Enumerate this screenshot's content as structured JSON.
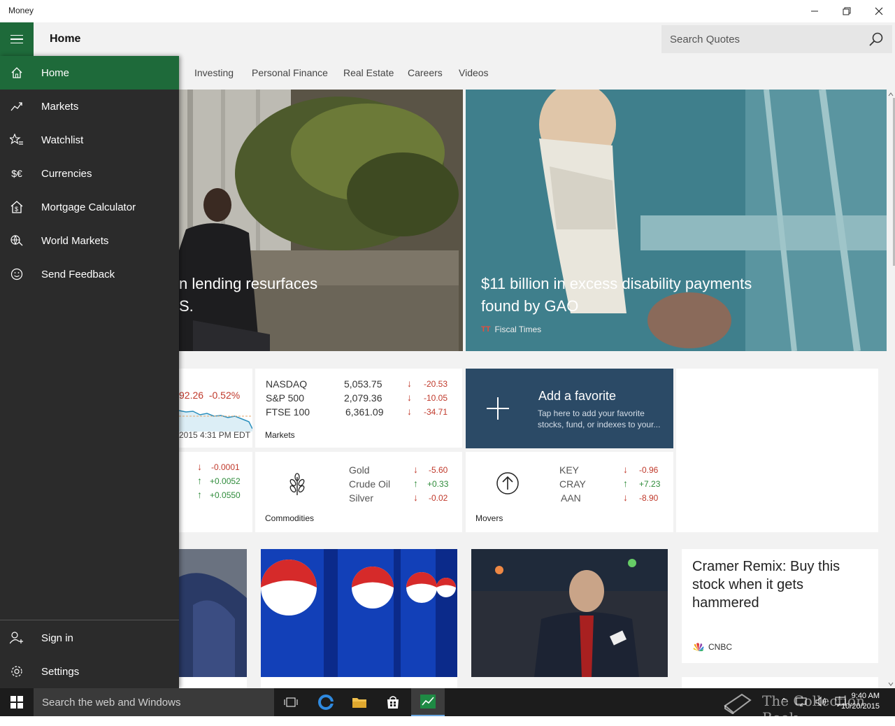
{
  "window": {
    "title": "Money"
  },
  "header": {
    "title": "Home",
    "search_placeholder": "Search Quotes"
  },
  "tabs": [
    "Investing",
    "Personal Finance",
    "Real Estate",
    "Careers",
    "Videos"
  ],
  "nav": {
    "items": [
      {
        "label": "Home",
        "icon": "home-icon"
      },
      {
        "label": "Markets",
        "icon": "trend-icon"
      },
      {
        "label": "Watchlist",
        "icon": "star-list-icon"
      },
      {
        "label": "Currencies",
        "icon": "currency-icon"
      },
      {
        "label": "Mortgage Calculator",
        "icon": "house-dollar-icon"
      },
      {
        "label": "World Markets",
        "icon": "globe-pin-icon"
      },
      {
        "label": "Send Feedback",
        "icon": "smiley-icon"
      }
    ],
    "bottom": [
      {
        "label": "Sign in",
        "icon": "person-add-icon"
      },
      {
        "label": "Settings",
        "icon": "gear-icon"
      }
    ]
  },
  "hero": {
    "left_caption_1": "n lending resurfaces",
    "left_caption_2": "S.",
    "right_caption_1": "$11 billion in excess disability payments",
    "right_caption_2": "found by GAO",
    "right_source": "Fiscal Times"
  },
  "index_tile": {
    "value": "92.26",
    "change": "-0.52%",
    "time": "2015 4:31 PM EDT"
  },
  "markets": {
    "label": "Markets",
    "rows": [
      {
        "name": "NASDAQ",
        "value": "5,053.75",
        "change": "-20.53",
        "dir": "down"
      },
      {
        "name": "S&P 500",
        "value": "2,079.36",
        "change": "-10.05",
        "dir": "down"
      },
      {
        "name": "FTSE 100",
        "value": "6,361.09",
        "change": "-34.71",
        "dir": "down"
      }
    ]
  },
  "favorite": {
    "title": "Add a favorite",
    "desc_1": "Tap here to add your favorite",
    "desc_2": "stocks, fund, or indexes to your..."
  },
  "currencies_partial": [
    {
      "change": "-0.0001",
      "dir": "down"
    },
    {
      "change": "+0.0052",
      "dir": "up"
    },
    {
      "change": "+0.0550",
      "dir": "up"
    }
  ],
  "commodities": {
    "label": "Commodities",
    "rows": [
      {
        "name": "Gold",
        "change": "-5.60",
        "dir": "down"
      },
      {
        "name": "Crude Oil",
        "change": "+0.33",
        "dir": "up"
      },
      {
        "name": "Silver",
        "change": "-0.02",
        "dir": "down"
      }
    ]
  },
  "movers": {
    "label": "Movers",
    "rows": [
      {
        "name": "KEY",
        "change": "-0.96",
        "dir": "down"
      },
      {
        "name": "CRAY",
        "change": "+7.23",
        "dir": "up"
      },
      {
        "name": "AAN",
        "change": "-8.90",
        "dir": "down"
      }
    ]
  },
  "cramer": {
    "title_1": "Cramer Remix: Buy this",
    "title_2": "stock when it gets",
    "title_3": "hammered",
    "source": "CNBC"
  },
  "taskbar": {
    "search": "Search the web and Windows",
    "time": "9:40 AM",
    "date": "10/20/2015",
    "watermark": "The Collection Book"
  },
  "colors": {
    "accent": "#1e6a3a",
    "nav_bg": "#2b2b2b",
    "favorite_bg": "#2b4a66",
    "down": "#c0392b",
    "up": "#2e8b3a"
  }
}
